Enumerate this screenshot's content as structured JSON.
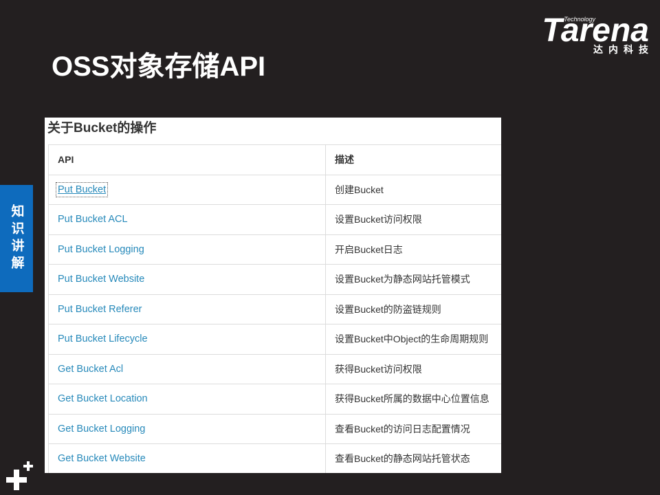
{
  "slide": {
    "title": "OSS对象存储API",
    "section_tab": "知识讲解"
  },
  "logo": {
    "technology": "Technology",
    "brand": "Tarena",
    "chinese_name": "达内科技"
  },
  "bucket_operations": {
    "heading": "关于Bucket的操作",
    "columns": {
      "api": "API",
      "description": "描述"
    },
    "rows": [
      {
        "api": "Put Bucket",
        "description": "创建Bucket"
      },
      {
        "api": "Put Bucket ACL",
        "description": "设置Bucket访问权限"
      },
      {
        "api": "Put Bucket Logging",
        "description": "开启Bucket日志"
      },
      {
        "api": "Put Bucket Website",
        "description": "设置Bucket为静态网站托管模式"
      },
      {
        "api": "Put Bucket Referer",
        "description": "设置Bucket的防盗链规则"
      },
      {
        "api": "Put Bucket Lifecycle",
        "description": "设置Bucket中Object的生命周期规则"
      },
      {
        "api": "Get Bucket Acl",
        "description": "获得Bucket访问权限"
      },
      {
        "api": "Get Bucket Location",
        "description": "获得Bucket所属的数据中心位置信息"
      },
      {
        "api": "Get Bucket Logging",
        "description": "查看Bucket的访问日志配置情况"
      },
      {
        "api": "Get Bucket Website",
        "description": "查看Bucket的静态网站托管状态"
      }
    ]
  },
  "icons": {
    "bottom_left": "plus-plus-icon"
  },
  "colors": {
    "background": "#231f20",
    "accent_tab": "#0e6bbd",
    "link": "#2689ba",
    "text": "#333333"
  }
}
